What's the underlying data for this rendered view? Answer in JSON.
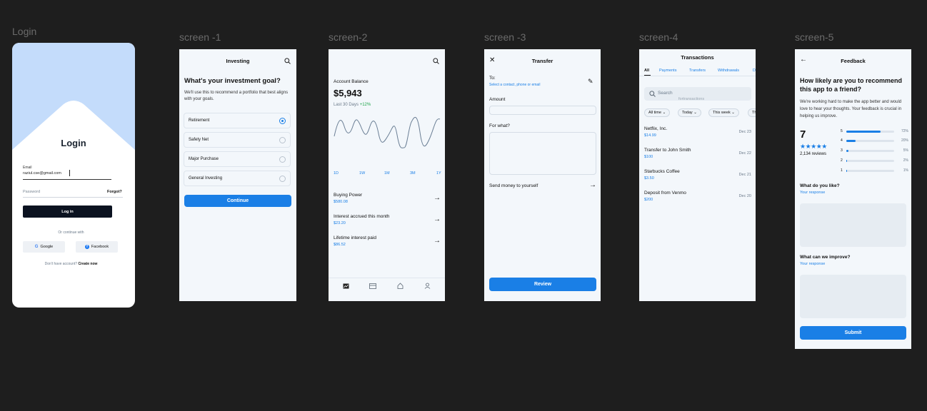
{
  "labels": {
    "login": "Login",
    "screen1": "screen -1",
    "screen2": "screen-2",
    "screen3": "screen -3",
    "screen4": "screen-4",
    "screen5": "screen-5"
  },
  "login": {
    "title": "Login",
    "email_label": "Email",
    "email_value": "raziul.cse@gmail.com",
    "password_placeholder": "Password",
    "forgot": "Forgot?",
    "login_button": "Log in",
    "or_continue": "Or continue with",
    "google": "Google",
    "facebook": "Facebook",
    "no_account": "Don't have account?",
    "create_now": "Create now"
  },
  "investing": {
    "header": "Investing",
    "question": "What's your investment goal?",
    "description": "We'll use this to recommend a portfolio that best aligns with your goals.",
    "options": [
      "Retirement",
      "Safety Net",
      "Major Purchase",
      "General Investing"
    ],
    "selected_index": 0,
    "continue": "Continue"
  },
  "balance": {
    "label": "Account Balance",
    "amount": "$5,943",
    "period": "Last 30 Days",
    "change": "+12%",
    "ranges": [
      "1D",
      "1W",
      "1M",
      "3M",
      "1Y"
    ],
    "items": [
      {
        "title": "Buying Power",
        "value": "$580.08"
      },
      {
        "title": "Interest accrued this month",
        "value": "$23.20"
      },
      {
        "title": "Lifetime interest paid",
        "value": "$86.52"
      }
    ],
    "nav_icons": [
      "chart-icon",
      "card-icon",
      "home-icon",
      "profile-icon"
    ]
  },
  "transfer": {
    "header": "Transfer",
    "to_label": "To:",
    "to_placeholder": "Select a contact, phone or email",
    "amount_label": "Amount",
    "for_label": "For what?",
    "send_self": "Send money to yourself",
    "review": "Review"
  },
  "transactions": {
    "header": "Transactions",
    "tabs": [
      "All",
      "Payments",
      "Transfers",
      "Withdrawals",
      "D"
    ],
    "search_placeholder": "Search",
    "search_hint": "fortransactions",
    "filters": [
      "All time",
      "Today",
      "This week",
      "Th"
    ],
    "rows": [
      {
        "name": "Netflix, Inc.",
        "amount": "$14.99",
        "date": "Dec 23"
      },
      {
        "name": "Transfer to John Smith",
        "amount": "$100",
        "date": "Dec 22"
      },
      {
        "name": "Starbucks Coffee",
        "amount": "$3.50",
        "date": "Dec 21"
      },
      {
        "name": "Deposit from Venmo",
        "amount": "$200",
        "date": "Dec 20"
      }
    ]
  },
  "feedback": {
    "header": "Feedback",
    "question": "How likely are you to recommend this app to a friend?",
    "description": "We're working hard to make the app better and would love to hear your thoughts. Your feedback is crucial in helping us improve.",
    "score": "7",
    "stars": "★★★★★",
    "reviews": "2,134 reviews",
    "ratings": [
      {
        "star": "5",
        "pct": "72%",
        "fraction": 0.72
      },
      {
        "star": "4",
        "pct": "20%",
        "fraction": 0.2
      },
      {
        "star": "3",
        "pct": "5%",
        "fraction": 0.05
      },
      {
        "star": "2",
        "pct": "2%",
        "fraction": 0.02
      },
      {
        "star": "1",
        "pct": "1%",
        "fraction": 0.01
      }
    ],
    "like_label": "What do you like?",
    "like_placeholder": "Your response",
    "improve_label": "What can we improve?",
    "improve_placeholder": "Your response",
    "submit": "Submit"
  },
  "colors": {
    "accent": "#1a7fe6",
    "positive": "#1fa54a",
    "dark_button": "#0b1220",
    "canvas": "#1e1e1e"
  }
}
